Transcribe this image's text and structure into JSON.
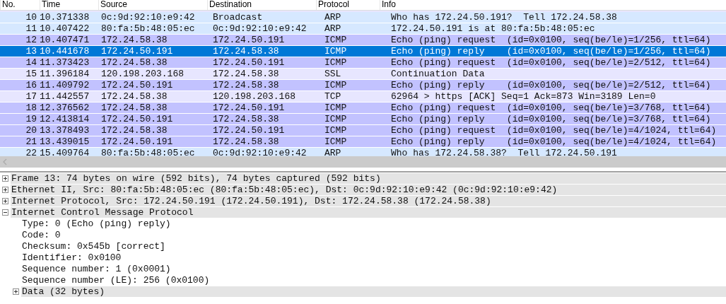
{
  "packet_list": {
    "columns": [
      "No.",
      "Time",
      "Source",
      "Destination",
      "Protocol",
      "Info"
    ],
    "rows": [
      {
        "cells": [
          "10",
          "10.371338",
          "0c:9d:92:10:e9:42",
          "Broadcast",
          "ARP",
          "Who has 172.24.50.191?  Tell 172.24.58.38"
        ],
        "color": "#d6e8ff",
        "selected": false
      },
      {
        "cells": [
          "11",
          "10.407422",
          "80:fa:5b:48:05:ec",
          "0c:9d:92:10:e9:42",
          "ARP",
          "172.24.50.191 is at 80:fa:5b:48:05:ec"
        ],
        "color": "#d6e8ff",
        "selected": false
      },
      {
        "cells": [
          "12",
          "10.407471",
          "172.24.58.38",
          "172.24.50.191",
          "ICMP",
          "Echo (ping) request  (id=0x0100, seq(be/le)=1/256, ttl=64)"
        ],
        "color": "#c2c2ff",
        "selected": false
      },
      {
        "cells": [
          "13",
          "10.441678",
          "172.24.50.191",
          "172.24.58.38",
          "ICMP",
          "Echo (ping) reply    (id=0x0100, seq(be/le)=1/256, ttl=64)"
        ],
        "selected": true
      },
      {
        "cells": [
          "14",
          "11.373423",
          "172.24.58.38",
          "172.24.50.191",
          "ICMP",
          "Echo (ping) request  (id=0x0100, seq(be/le)=2/512, ttl=64)"
        ],
        "color": "#c2c2ff",
        "selected": false
      },
      {
        "cells": [
          "15",
          "11.396184",
          "120.198.203.168",
          "172.24.58.38",
          "SSL",
          "Continuation Data"
        ],
        "color": "#e7e6ff",
        "selected": false
      },
      {
        "cells": [
          "16",
          "11.409792",
          "172.24.50.191",
          "172.24.58.38",
          "ICMP",
          "Echo (ping) reply    (id=0x0100, seq(be/le)=2/512, ttl=64)"
        ],
        "color": "#c2c2ff",
        "selected": false
      },
      {
        "cells": [
          "17",
          "11.442557",
          "172.24.58.38",
          "120.198.203.168",
          "TCP",
          "62964 > https [ACK] Seq=1 Ack=873 Win=3189 Len=0"
        ],
        "color": "#e7e6ff",
        "selected": false
      },
      {
        "cells": [
          "18",
          "12.376562",
          "172.24.58.38",
          "172.24.50.191",
          "ICMP",
          "Echo (ping) request  (id=0x0100, seq(be/le)=3/768, ttl=64)"
        ],
        "color": "#c2c2ff",
        "selected": false
      },
      {
        "cells": [
          "19",
          "12.413814",
          "172.24.50.191",
          "172.24.58.38",
          "ICMP",
          "Echo (ping) reply    (id=0x0100, seq(be/le)=3/768, ttl=64)"
        ],
        "color": "#c2c2ff",
        "selected": false
      },
      {
        "cells": [
          "20",
          "13.378493",
          "172.24.58.38",
          "172.24.50.191",
          "ICMP",
          "Echo (ping) request  (id=0x0100, seq(be/le)=4/1024, ttl=64)"
        ],
        "color": "#c2c2ff",
        "selected": false
      },
      {
        "cells": [
          "21",
          "13.439015",
          "172.24.50.191",
          "172.24.58.38",
          "ICMP",
          "Echo (ping) reply    (id=0x0100, seq(be/le)=4/1024, ttl=64)"
        ],
        "color": "#c2c2ff",
        "selected": false
      },
      {
        "cells": [
          "22",
          "15.409764",
          "80:fa:5b:48:05:ec",
          "0c:9d:92:10:e9:42",
          "ARP",
          "Who has 172.24.58.38?  Tell 172.24.50.191"
        ],
        "color": "#d6e8ff",
        "selected": false
      }
    ]
  },
  "details": {
    "items": [
      {
        "text": "Frame 13: 74 bytes on wire (592 bits), 74 bytes captured (592 bits)",
        "expanded": false
      },
      {
        "text": "Ethernet II, Src: 80:fa:5b:48:05:ec (80:fa:5b:48:05:ec), Dst: 0c:9d:92:10:e9:42 (0c:9d:92:10:e9:42)",
        "expanded": false
      },
      {
        "text": "Internet Protocol, Src: 172.24.50.191 (172.24.50.191), Dst: 172.24.58.38 (172.24.58.38)",
        "expanded": false
      },
      {
        "text": "Internet Control Message Protocol",
        "expanded": true,
        "children": [
          {
            "text": "Type: 0 (Echo (ping) reply)"
          },
          {
            "text": "Code: 0"
          },
          {
            "text": "Checksum: 0x545b [correct]"
          },
          {
            "text": "Identifier: 0x0100"
          },
          {
            "text": "Sequence number: 1 (0x0001)"
          },
          {
            "text": "Sequence number (LE): 256 (0x0100)"
          },
          {
            "text": "Data (32 bytes)",
            "expanded": false
          }
        ]
      }
    ]
  }
}
